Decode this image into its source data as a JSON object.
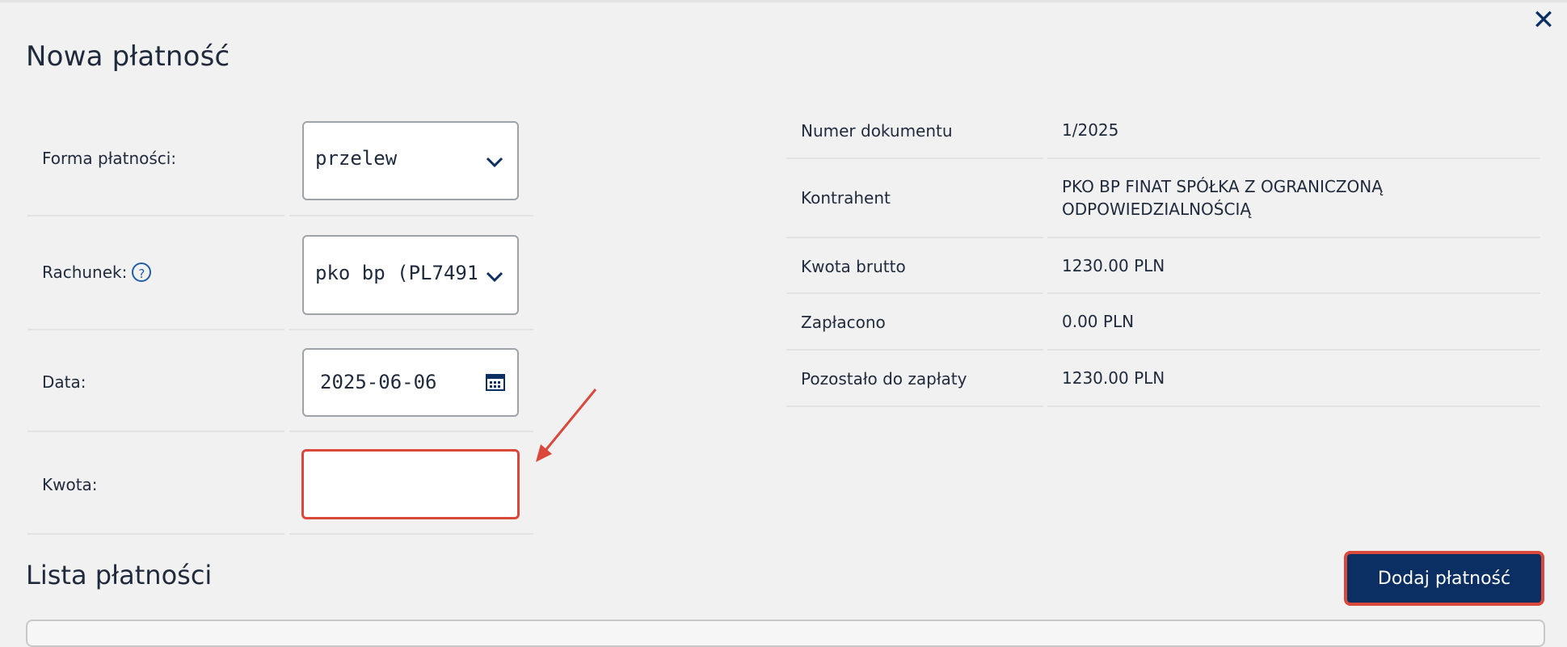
{
  "modal": {
    "title": "Nowa płatność",
    "close_icon": "close-icon"
  },
  "form": {
    "payment_method": {
      "label": "Forma płatności:",
      "value": "przelew"
    },
    "account": {
      "label": "Rachunek:",
      "value": "pko bp (PL7491",
      "help_icon": "?"
    },
    "date": {
      "label": "Data:",
      "value": "2025-06-06"
    },
    "amount": {
      "label": "Kwota:",
      "value": ""
    }
  },
  "document_info": [
    {
      "key": "Numer dokumentu",
      "value": "1/2025"
    },
    {
      "key": "Kontrahent",
      "value": "PKO BP FINAT SPÓŁKA Z OGRANICZONĄ ODPOWIEDZIALNOŚCIĄ"
    },
    {
      "key": "Kwota brutto",
      "value": "1230.00 PLN"
    },
    {
      "key": "Zapłacono",
      "value": "0.00 PLN"
    },
    {
      "key": "Pozostało do zapłaty",
      "value": "1230.00 PLN"
    }
  ],
  "payments": {
    "title": "Lista płatności",
    "add_button": "Dodaj płatność"
  },
  "colors": {
    "primary": "#0b2f63",
    "highlight": "#d9483b",
    "background": "#f1f1f1"
  }
}
